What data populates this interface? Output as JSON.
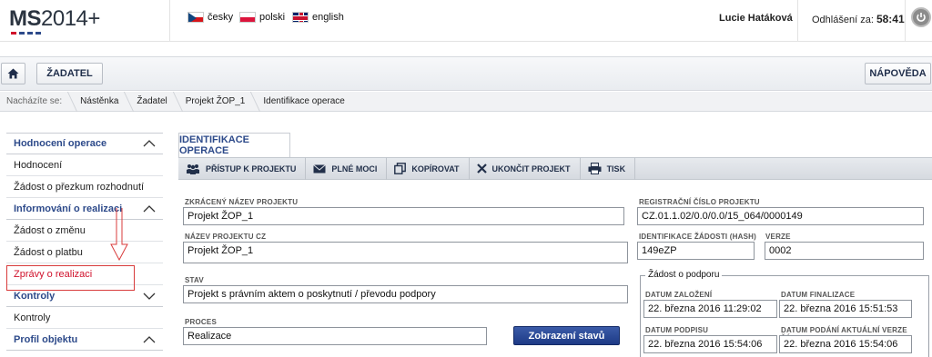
{
  "header": {
    "logo": {
      "ms": "MS",
      "year": "2014+"
    },
    "languages": [
      {
        "label": "česky"
      },
      {
        "label": "polski"
      },
      {
        "label": "english"
      }
    ],
    "user": "Lucie Hatáková",
    "logout_label": "Odhlášení za:",
    "logout_timer": "58:41"
  },
  "actionbar": {
    "home_icon": "home-icon",
    "zadatel": "ŽADATEL",
    "napoveda": "NÁPOVĚDA"
  },
  "breadcrumb": {
    "label": "Nacházíte se:",
    "items": [
      "Nástěnka",
      "Žadatel",
      "Projekt ŽOP_1",
      "Identifikace operace"
    ]
  },
  "sidebar": {
    "sections": [
      {
        "title": "Hodnocení operace",
        "items": [
          "Hodnocení",
          "Žádost o přezkum rozhodnutí"
        ]
      },
      {
        "title": "Informování o realizaci",
        "items": [
          "Žádost o změnu",
          "Žádost o platbu",
          "Zprávy o realizaci"
        ]
      },
      {
        "title": "Kontroly",
        "items": [
          "Kontroly"
        ]
      },
      {
        "title": "Profil objektu",
        "items": []
      }
    ]
  },
  "main": {
    "tab": "IDENTIFIKACE OPERACE",
    "toolbar": [
      {
        "label": "PŘÍSTUP K PROJEKTU",
        "icon": "people-icon"
      },
      {
        "label": "PLNÉ MOCI",
        "icon": "envelope-icon"
      },
      {
        "label": "KOPÍROVAT",
        "icon": "copy-icon"
      },
      {
        "label": "UKONČIT PROJEKT",
        "icon": "close-icon"
      },
      {
        "label": "TISK",
        "icon": "print-icon"
      }
    ],
    "fields": {
      "short_name": {
        "label": "ZKRÁCENÝ NÁZEV PROJEKTU",
        "value": "Projekt ŽOP_1"
      },
      "name_cz": {
        "label": "NÁZEV PROJEKTU CZ",
        "value": "Projekt ŽOP_1"
      },
      "stav": {
        "label": "STAV",
        "value": "Projekt s právním aktem o poskytnutí / převodu podpory"
      },
      "proces": {
        "label": "PROCES",
        "value": "Realizace"
      },
      "reg_number": {
        "label": "REGISTRAČNÍ ČÍSLO PROJEKTU",
        "value": "CZ.01.1.02/0.0/0.0/15_064/0000149"
      },
      "hash": {
        "label": "IDENTIFIKACE ŽÁDOSTI (HASH)",
        "value": "149eZP"
      },
      "verze": {
        "label": "VERZE",
        "value": "0002"
      }
    },
    "zobrazeni_button": "Zobrazení stavů",
    "zadost": {
      "legend": "Žádost o podporu",
      "datum_zalozeni": {
        "label": "DATUM ZALOŽENÍ",
        "value": "22. března 2016 11:29:02"
      },
      "datum_finalizace": {
        "label": "DATUM FINALIZACE",
        "value": "22. března 2016 15:51:53"
      },
      "datum_podpisu": {
        "label": "DATUM PODPISU",
        "value": "22. března 2016 15:54:06"
      },
      "datum_podani": {
        "label": "DATUM PODÁNÍ AKTUÁLNÍ VERZE ŽÁDOSTI",
        "value": "22. března 2016 15:54:06"
      }
    }
  },
  "colors": {
    "brand_blue": "#2d4a8a",
    "active_red": "#d0112b",
    "button_blue": "#1d3a86"
  }
}
